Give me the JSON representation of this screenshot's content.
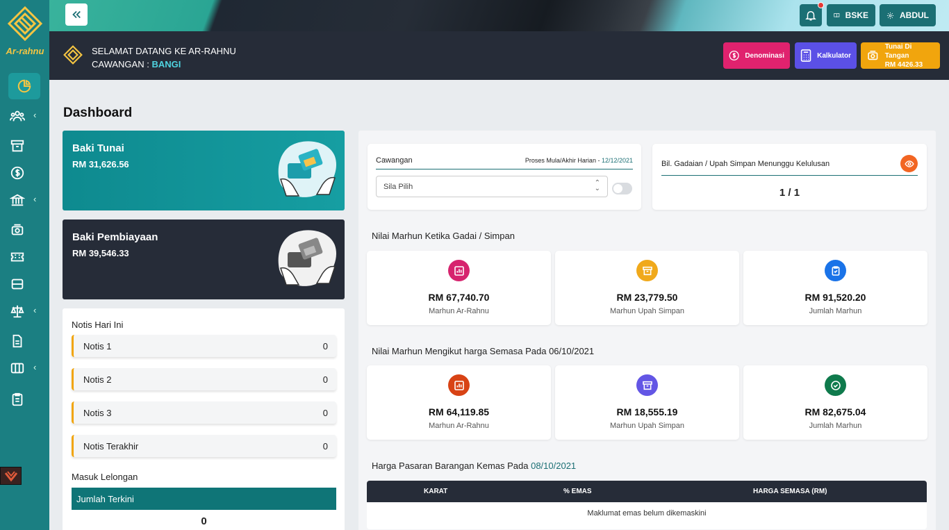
{
  "sidebar": {
    "logo_text": "Ar-rahnu",
    "items": [
      "dashboard-icon",
      "customers-icon",
      "archive-icon",
      "dollar-icon",
      "bank-icon",
      "cash-icon",
      "ticket-icon",
      "wallet-icon",
      "scale-icon",
      "document-icon",
      "columns-icon",
      "clipboard-icon"
    ]
  },
  "topbar": {
    "bske_label": "BSKE",
    "user_label": "ABDUL"
  },
  "welcome": {
    "line1": "SELAMAT DATANG KE AR-RAHNU",
    "line2_prefix": "CAWANGAN : ",
    "branch": "BANGI"
  },
  "quick": {
    "denominasi": "Denominasi",
    "kalkulator": "Kalkulator",
    "tunai_title": "Tunai Di Tangan",
    "tunai_value": "RM 4426.33"
  },
  "page_title": "Dashboard",
  "baki_tunai": {
    "title": "Baki Tunai",
    "value": "RM 31,626.56"
  },
  "baki_pembiayaan": {
    "title": "Baki Pembiayaan",
    "value": "RM 39,546.33"
  },
  "notis": {
    "heading": "Notis Hari Ini",
    "items": [
      {
        "label": "Notis 1",
        "count": "0"
      },
      {
        "label": "Notis 2",
        "count": "0"
      },
      {
        "label": "Notis 3",
        "count": "0"
      },
      {
        "label": "Notis Terakhir",
        "count": "0"
      }
    ]
  },
  "lelongan": {
    "heading": "Masuk Lelongan",
    "label": "Jumlah Terkini",
    "value": "0"
  },
  "cawangan_box": {
    "label": "Cawangan",
    "proses_label": "Proses Mula/Akhir Harian - ",
    "proses_date": "12/12/2021",
    "select_placeholder": "Sila Pilih"
  },
  "approval_box": {
    "label": "Bil. Gadaian / Upah Simpan Menunggu Kelulusan",
    "value": "1 / 1"
  },
  "nilai_gadai": {
    "heading": "Nilai Marhun Ketika Gadai / Simpan",
    "stats": [
      {
        "amount": "RM 67,740.70",
        "label": "Marhun Ar-Rahnu",
        "color": "#d6246e",
        "icon": "bar-chart-icon"
      },
      {
        "amount": "RM 23,779.50",
        "label": "Marhun Upah Simpan",
        "color": "#f0a91b",
        "icon": "archive-icon"
      },
      {
        "amount": "RM 91,520.20",
        "label": "Jumlah Marhun",
        "color": "#1a73e8",
        "icon": "clipboard-check-icon"
      }
    ]
  },
  "nilai_semasa": {
    "heading": "Nilai Marhun Mengikut harga Semasa Pada 06/10/2021",
    "stats": [
      {
        "amount": "RM 64,119.85",
        "label": "Marhun Ar-Rahnu",
        "color": "#d84315",
        "icon": "bar-chart-icon"
      },
      {
        "amount": "RM 18,555.19",
        "label": "Marhun Upah Simpan",
        "color": "#6356e5",
        "icon": "archive-icon"
      },
      {
        "amount": "RM 82,675.04",
        "label": "Jumlah Marhun",
        "color": "#0f7a4c",
        "icon": "check-circle-icon"
      }
    ]
  },
  "harga": {
    "heading_prefix": "Harga Pasaran Barangan Kemas Pada ",
    "date": "08/10/2021",
    "columns": [
      "KARAT",
      "% EMAS",
      "HARGA SEMASA (RM)"
    ],
    "empty_message": "Maklumat emas belum dikemaskini"
  }
}
